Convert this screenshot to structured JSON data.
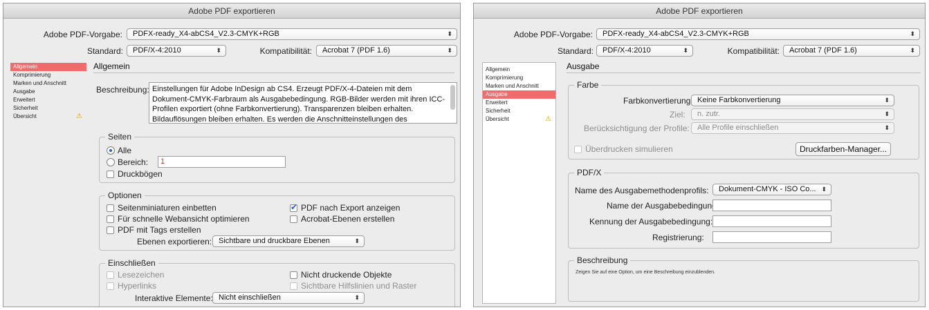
{
  "left": {
    "title": "Adobe PDF exportieren",
    "preset_label": "Adobe PDF-Vorgabe:",
    "preset_value": "PDFX-ready_X4-abCS4_V2.3-CMYK+RGB",
    "standard_label": "Standard:",
    "standard_value": "PDF/X-4:2010",
    "compat_label": "Kompatibilität:",
    "compat_value": "Acrobat 7 (PDF 1.6)",
    "sidebar": [
      "Allgemein",
      "Komprimierung",
      "Marken und Anschnitt",
      "Ausgabe",
      "Erweitert",
      "Sicherheit",
      "Übersicht"
    ],
    "active_index": 0,
    "section_title": "Allgemein",
    "desc_label": "Beschreibung:",
    "desc_text": "Einstellungen für Adobe InDesign ab CS4. Erzeugt PDF/X-4-Dateien mit dem Dokument-CMYK-Farbraum als Ausgabebedingung. RGB-Bilder werden mit ihren ICC-Profilen exportiert (ohne Farbkonvertierung). Transparenzen bleiben erhalten. Bildauflösungen bleiben erhalten. Es werden die Anschnitteinstellungen des Dokuments verwendet. Weitere Informationen zu Arbeitsweisen unter www.pdfx-ready.ch",
    "pages": {
      "legend": "Seiten",
      "all": "Alle",
      "range": "Bereich:",
      "range_value": "1",
      "spreads": "Druckbögen"
    },
    "options": {
      "legend": "Optionen",
      "thumbs": "Seitenminiaturen einbetten",
      "fastweb": "Für schnelle Webansicht optimieren",
      "tagged": "PDF mit Tags erstellen",
      "viewafter": "PDF nach Export anzeigen",
      "acrolayers": "Acrobat-Ebenen erstellen",
      "export_layers_label": "Ebenen exportieren:",
      "export_layers_value": "Sichtbare und druckbare Ebenen"
    },
    "include": {
      "legend": "Einschließen",
      "bookmarks": "Lesezeichen",
      "hyperlinks": "Hyperlinks",
      "nonprint": "Nicht druckende Objekte",
      "guides": "Sichtbare Hilfslinien und Raster",
      "interactive_label": "Interaktive Elemente:",
      "interactive_value": "Nicht einschließen"
    }
  },
  "right": {
    "title": "Adobe PDF exportieren",
    "preset_label": "Adobe PDF-Vorgabe:",
    "preset_value": "PDFX-ready_X4-abCS4_V2.3-CMYK+RGB",
    "standard_label": "Standard:",
    "standard_value": "PDF/X-4:2010",
    "compat_label": "Kompatibilität:",
    "compat_value": "Acrobat 7 (PDF 1.6)",
    "sidebar": [
      "Allgemein",
      "Komprimierung",
      "Marken und Anschnitt",
      "Ausgabe",
      "Erweitert",
      "Sicherheit",
      "Übersicht"
    ],
    "active_index": 3,
    "section_title": "Ausgabe",
    "color": {
      "legend": "Farbe",
      "conv_label": "Farbkonvertierung:",
      "conv_value": "Keine Farbkonvertierung",
      "dest_label": "Ziel:",
      "dest_value": "n. zutr.",
      "profile_label": "Berücksichtigung der Profile:",
      "profile_value": "Alle Profile einschließen",
      "overprint": "Überdrucken simulieren",
      "ink_button": "Druckfarben-Manager..."
    },
    "pdfx": {
      "legend": "PDF/X",
      "profile_label": "Name des Ausgabemethodenprofils:",
      "profile_value": "Dokument-CMYK - ISO Co...",
      "cond_name_label": "Name der Ausgabebedingung:",
      "cond_id_label": "Kennung der Ausgabebedingung:",
      "registry_label": "Registrierung:"
    },
    "description": {
      "legend": "Beschreibung",
      "hint": "Zeigen Sie auf eine Option, um eine Beschreibung einzublenden."
    }
  }
}
